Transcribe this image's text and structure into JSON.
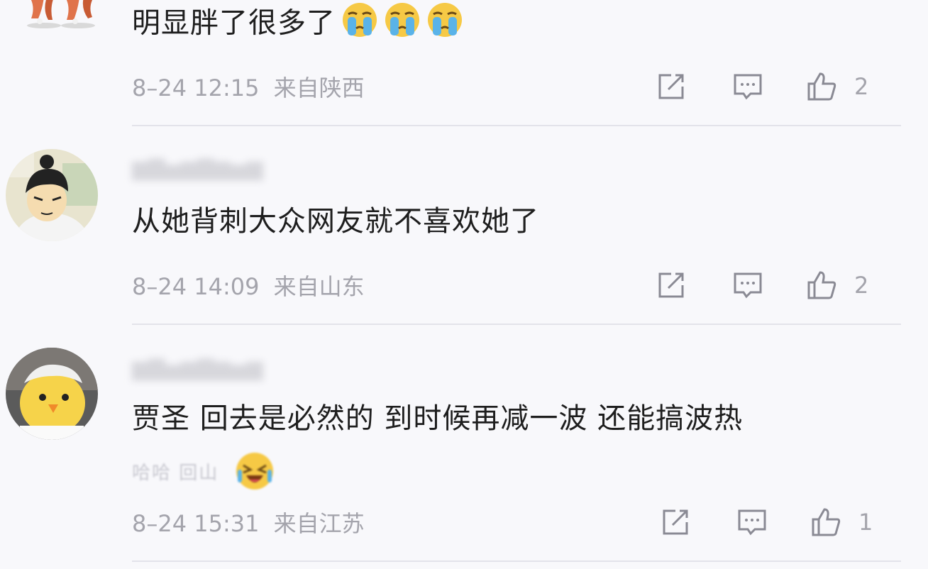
{
  "comments": [
    {
      "text": "明显胖了很多了",
      "emoji": [
        "crying-emoji",
        "crying-emoji",
        "crying-emoji"
      ],
      "time": "8–24 12:15",
      "location": "来自陕西",
      "likes": "2"
    },
    {
      "text": "从她背刺大众网友就不喜欢她了",
      "time": "8–24 14:09",
      "location": "来自山东",
      "likes": "2"
    },
    {
      "text": "贾圣 回去是必然的 到时候再减一波 还能搞波热",
      "second_line": "哈哈 回山",
      "emoji": [
        "laughing-emoji"
      ],
      "time": "8–24 15:31",
      "location": "来自江苏",
      "likes": "1"
    }
  ],
  "icons": {
    "share": "share-icon",
    "comment": "comment-icon",
    "like": "thumbs-up-icon"
  },
  "colors": {
    "background": "#f8f8fb",
    "meta_text": "#a4a4ac",
    "body_text": "#1e1e1e",
    "divider": "#e3e3ea"
  }
}
